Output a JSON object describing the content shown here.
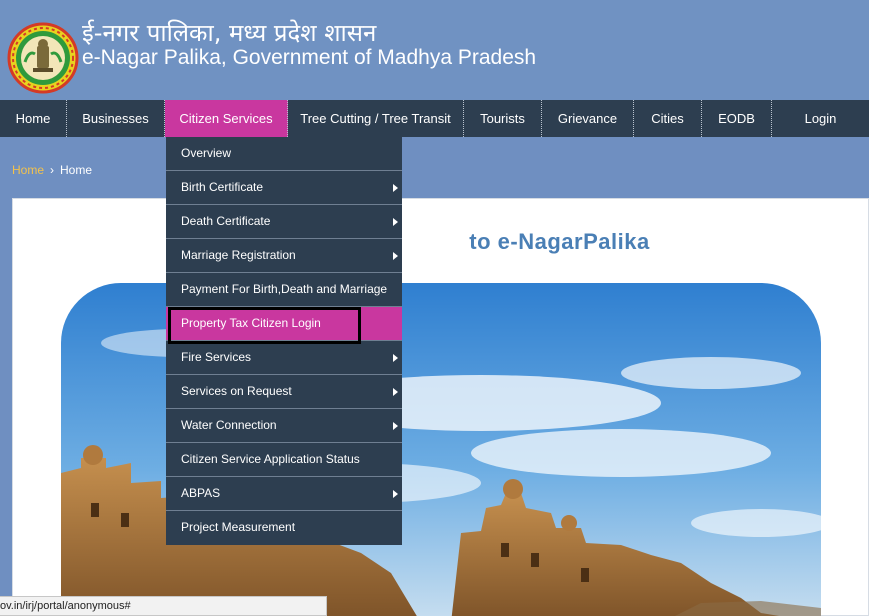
{
  "header": {
    "title_hindi": "ई-नगर पालिका, मध्य प्रदेश शासन",
    "title_english": "e-Nagar Palika, Government of Madhya Pradesh",
    "logo_icon": "mp-government-emblem-icon"
  },
  "nav": {
    "items": [
      {
        "label": "Home"
      },
      {
        "label": "Businesses"
      },
      {
        "label": "Citizen Services",
        "active": true
      },
      {
        "label": "Tree Cutting / Tree Transit"
      },
      {
        "label": "Tourists"
      },
      {
        "label": "Grievance"
      },
      {
        "label": "Cities"
      },
      {
        "label": "EODB"
      },
      {
        "label": "Login"
      }
    ]
  },
  "breadcrumb": {
    "link": "Home",
    "separator": "›",
    "current": "Home"
  },
  "main": {
    "welcome_text": "to e-NagarPalika"
  },
  "dropdown": {
    "items": [
      {
        "label": "Overview",
        "submenu": false
      },
      {
        "label": "Birth Certificate",
        "submenu": true
      },
      {
        "label": "Death Certificate",
        "submenu": true
      },
      {
        "label": "Marriage Registration",
        "submenu": true
      },
      {
        "label": "Payment For Birth,Death and Marriage",
        "submenu": false
      },
      {
        "label": "Property Tax Citizen Login",
        "submenu": false,
        "highlighted": true
      },
      {
        "label": "Fire Services",
        "submenu": true
      },
      {
        "label": "Services on Request",
        "submenu": true
      },
      {
        "label": "Water Connection",
        "submenu": true
      },
      {
        "label": "Citizen Service Application Status",
        "submenu": false
      },
      {
        "label": "ABPAS",
        "submenu": true
      },
      {
        "label": "Project Measurement",
        "submenu": false
      }
    ]
  },
  "statusbar": {
    "url": "ov.in/irj/portal/anonymous#"
  },
  "colors": {
    "header_bg": "#7092c2",
    "nav_bg": "#2d3e50",
    "accent": "#c9379f",
    "breadcrumb_link": "#f3c24c",
    "welcome_text": "#4a7fb5"
  }
}
